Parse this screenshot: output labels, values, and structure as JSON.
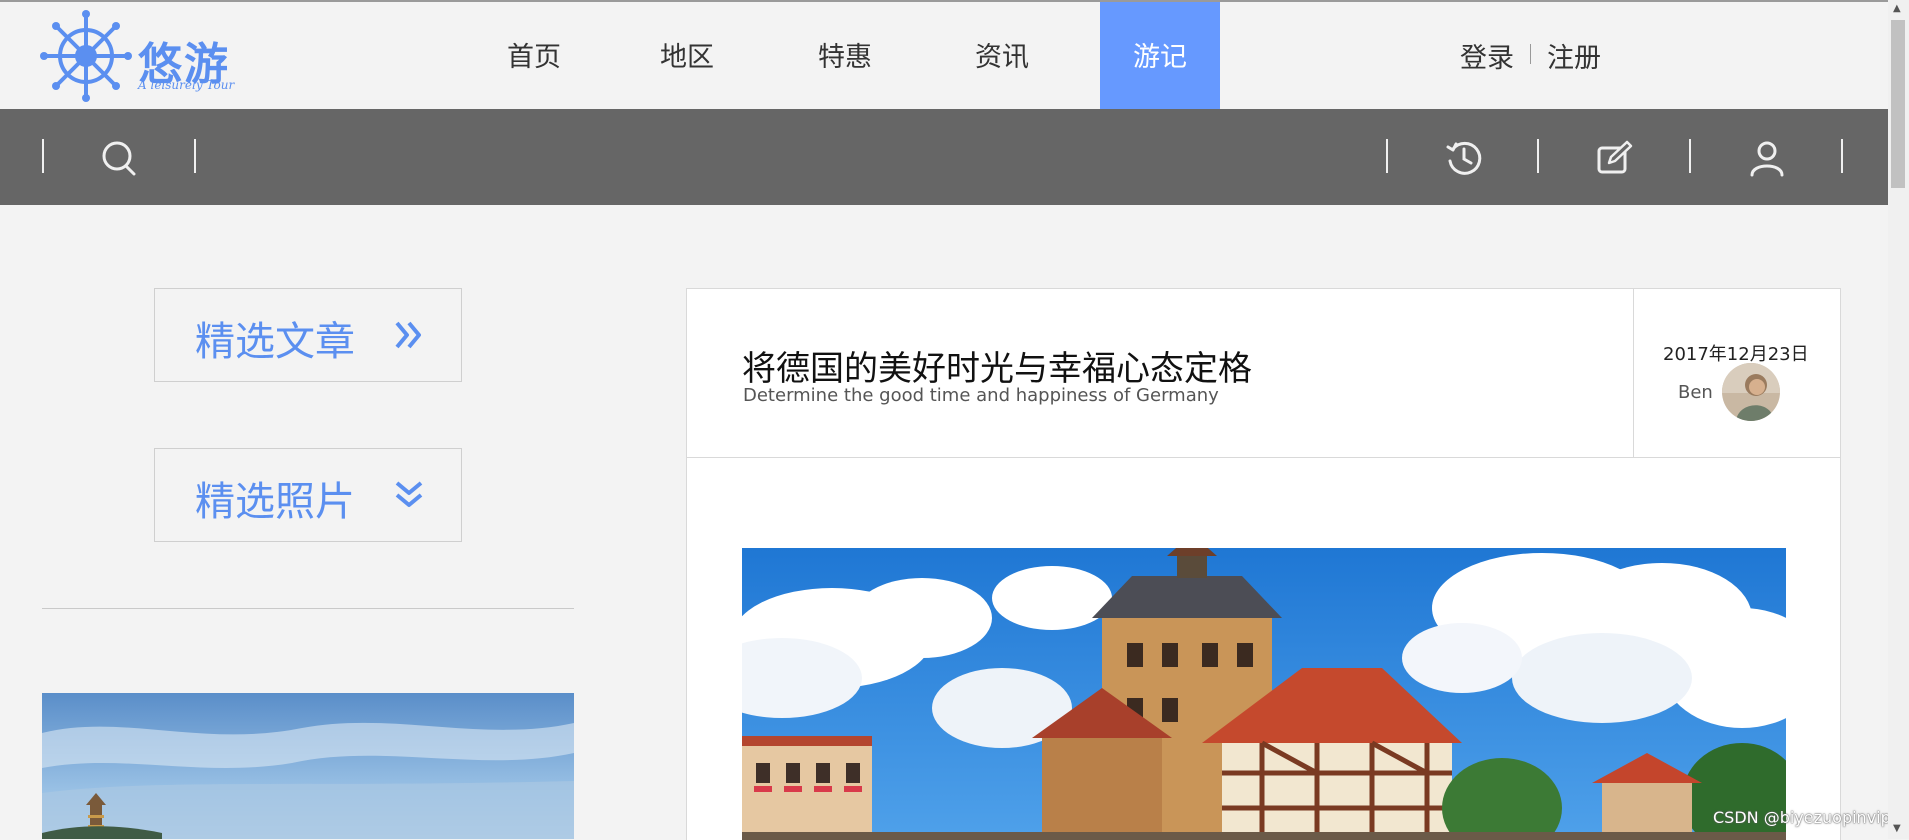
{
  "logo": {
    "name": "悠游",
    "tagline": "A leisurely Tour",
    "accent_color": "#5b8ff0"
  },
  "nav": {
    "items": [
      {
        "label": "首页",
        "active": false
      },
      {
        "label": "地区",
        "active": false
      },
      {
        "label": "特惠",
        "active": false
      },
      {
        "label": "资讯",
        "active": false
      },
      {
        "label": "游记",
        "active": true
      }
    ],
    "active_color": "#6699ff"
  },
  "auth": {
    "login": "登录",
    "register": "注册"
  },
  "toolbar": {
    "background": "#666666",
    "icons": [
      "search-icon",
      "history-icon",
      "edit-icon",
      "user-icon"
    ]
  },
  "sidebar": {
    "featured_articles": "精选文章",
    "featured_photos": "精选照片"
  },
  "article": {
    "title": "将德国的美好时光与幸福心态定格",
    "subtitle": "Determine the good time and happiness of Germany",
    "date": "2017年12月23日",
    "author": "Ben"
  },
  "watermark": "CSDN @biyezuopinvip"
}
